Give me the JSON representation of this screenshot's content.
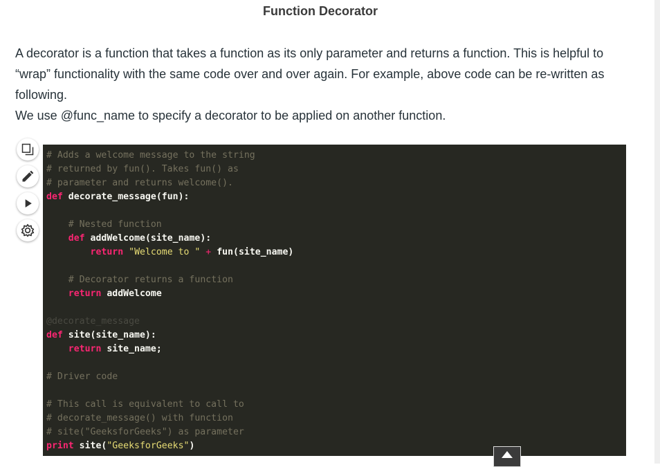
{
  "article": {
    "title": "Function Decorator",
    "paragraph_1": "A decorator is a function that takes a function as its only parameter and returns a function. This is helpful to “wrap” functionality with the same code over and over again. For example, above code can be re-written as following.",
    "paragraph_2": "We use @func_name to specify a decorator to be applied on another function."
  },
  "toolbar": {
    "copy_icon": "copy-icon",
    "edit_icon": "pencil-icon",
    "run_icon": "play-icon",
    "settings_icon": "gear-icon"
  },
  "code": {
    "theme": {
      "background": "#272822",
      "comment": "#75715e",
      "keyword": "#f92672",
      "string": "#e6db74",
      "text": "#f8f8f2"
    },
    "l1": "# Adds a welcome message to the string",
    "l2": "# returned by fun(). Takes fun() as",
    "l3": "# parameter and returns welcome().",
    "l4_kw": "def",
    "l4_rest": "decorate_message(fun):",
    "l6": "# Nested function",
    "l7_kw": "def",
    "l7_rest": "addWelcome(site_name):",
    "l8_kw": "return",
    "l8_str": "\"Welcome to \"",
    "l8_op": "+",
    "l8_rest": "fun(site_name)",
    "l10": "# Decorator returns a function",
    "l11_kw": "return",
    "l11_rest": "addWelcome",
    "l13": "@decorate_message",
    "l14_kw": "def",
    "l14_rest": "site(site_name):",
    "l15_kw": "return",
    "l15_rest": "site_name;",
    "l17": "# Driver code",
    "l19": "# This call is equivalent to call to",
    "l20": "# decorate_message() with function",
    "l21": "# site(\"GeeksforGeeks\") as parameter",
    "l22_kw": "print",
    "l22_rest": "site(",
    "l22_str": "\"GeeksforGeeks\"",
    "l22_end": ")"
  },
  "scroll_top": {
    "icon": "arrow-up-icon"
  }
}
